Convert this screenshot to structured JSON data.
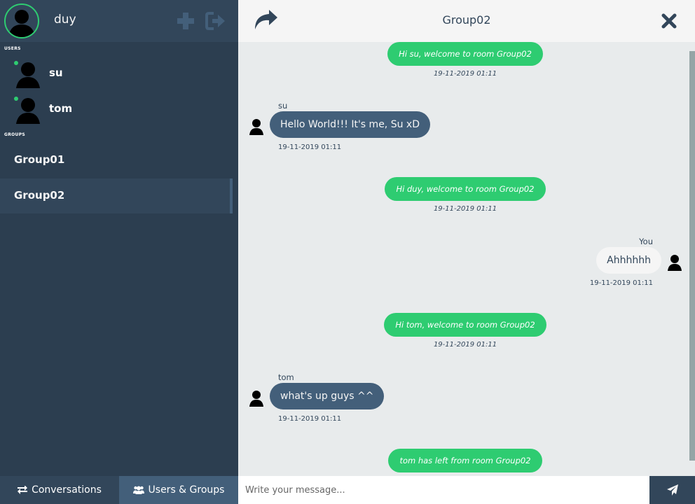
{
  "profile": {
    "username": "duy",
    "status_color": "#2ecc71",
    "add_icon": "plus-icon",
    "logout_icon": "sign-out-icon"
  },
  "sidebar": {
    "users_label": "USERS",
    "groups_label": "GROUPS",
    "users": [
      {
        "name": "su",
        "online": true
      },
      {
        "name": "tom",
        "online": true
      }
    ],
    "groups": [
      {
        "name": "Group01",
        "active": false
      },
      {
        "name": "Group02",
        "active": true
      }
    ]
  },
  "tabs": {
    "conversations": {
      "label": "Conversations",
      "icon": "exchange-icon"
    },
    "users_groups": {
      "label": "Users & Groups",
      "icon": "users-icon"
    }
  },
  "chat": {
    "title": "Group02",
    "forward_icon": "share-icon",
    "close_icon": "close-icon",
    "messages": [
      {
        "kind": "system",
        "text": "Hi su, welcome to room Group02",
        "time": "19-11-2019 01:11"
      },
      {
        "kind": "incoming",
        "sender": "su",
        "text": "Hello World!!! It's me, Su xD",
        "time": "19-11-2019 01:11"
      },
      {
        "kind": "system",
        "text": "Hi duy, welcome to room Group02",
        "time": "19-11-2019 01:11"
      },
      {
        "kind": "outgoing",
        "sender": "You",
        "text": "Ahhhhhh",
        "time": "19-11-2019 01:11"
      },
      {
        "kind": "system",
        "text": "Hi tom, welcome to room Group02",
        "time": "19-11-2019 01:11"
      },
      {
        "kind": "incoming",
        "sender": "tom",
        "text": "what's up guys ^^",
        "time": "19-11-2019 01:11"
      },
      {
        "kind": "system",
        "text": "tom has left from room Group02",
        "time": ""
      }
    ]
  },
  "composer": {
    "placeholder": "Write your message...",
    "send_icon": "paper-plane-icon"
  },
  "colors": {
    "sidebar": "#2c3e50",
    "accent": "#2ecc71",
    "bubble_incoming": "#435f7a",
    "chat_bg": "#e8ebec"
  }
}
